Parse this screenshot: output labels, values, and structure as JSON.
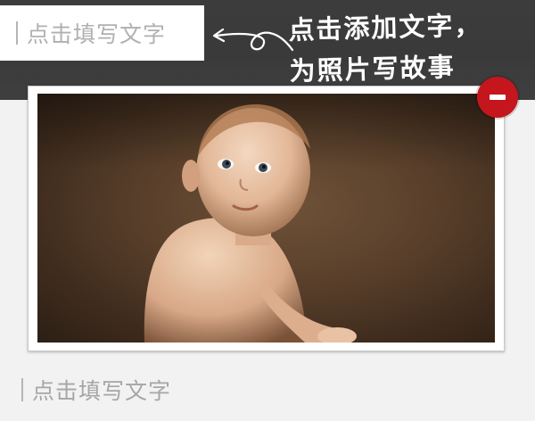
{
  "caption_top": {
    "placeholder": "点击填写文字"
  },
  "hint": {
    "line1": "点击添加文字，",
    "line2": "为照片写故事"
  },
  "caption_bottom": {
    "placeholder": "点击填写文字"
  },
  "photo": {
    "subject": "baby-portrait"
  },
  "delete_button": {
    "icon": "minus-icon",
    "color": "#c4161c"
  },
  "colors": {
    "band": "#3c3c3c",
    "background": "#f2f2f2",
    "hint_text": "#ffffff"
  }
}
